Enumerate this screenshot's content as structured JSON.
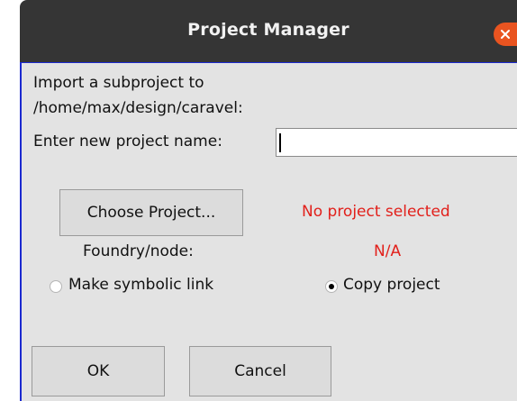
{
  "window": {
    "title": "Project Manager"
  },
  "dialog": {
    "import_line1": "Import a subproject to",
    "import_line2": "/home/max/design/caravel:",
    "name_label": "Enter new project name:",
    "name_value": "",
    "choose_button": "Choose Project...",
    "project_status": "No project selected",
    "foundry_label": "Foundry/node:",
    "foundry_value": "N/A",
    "radio_symbolic_label": "Make symbolic link",
    "radio_copy_label": "Copy project",
    "selected_option": "Copy project",
    "ok_button": "OK",
    "cancel_button": "Cancel"
  },
  "colors": {
    "titlebar": "#353535",
    "dialog_bg": "#e3e3e3",
    "close_accent": "#e95420",
    "status_red": "#e2201b",
    "focus_border": "#1c2ad0"
  },
  "icons": {
    "close": "close-icon"
  }
}
